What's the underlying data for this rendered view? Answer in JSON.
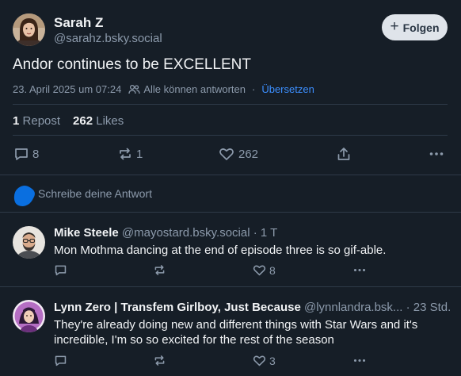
{
  "main_post": {
    "author_name": "Sarah Z",
    "author_handle": "@sarahz.bsky.social",
    "follow_label": "Folgen",
    "text": "Andor continues to be EXCELLENT",
    "timestamp": "23. April 2025 um 07:24",
    "reply_setting": "Alle können antworten",
    "translate_label": "Übersetzen",
    "reposts_count": "1",
    "reposts_label": "Repost",
    "likes_count": "262",
    "likes_label": "Likes",
    "actions": {
      "reply_count": "8",
      "repost_count": "1",
      "like_count": "262"
    }
  },
  "composer": {
    "placeholder": "Schreibe deine Antwort"
  },
  "replies": [
    {
      "author_name": "Mike Steele",
      "author_handle": "@mayostard.bsky.social",
      "time": "1 T",
      "text": "Mon Mothma dancing at the end of episode three is so gif-able.",
      "like_count": "8"
    },
    {
      "author_name": "Lynn Zero | Transfem Girlboy, Just Because",
      "author_handle": "@lynnlandra.bsk...",
      "time": "23 Std.",
      "text": "They're already doing new and different things with Star Wars and it's incredible, I'm so so excited for the rest of the season",
      "like_count": "3"
    }
  ],
  "colors": {
    "background": "#161e27",
    "text": "#f1f3f5",
    "muted": "#8c9aab",
    "accent": "#3c8fff",
    "divider": "#2e3a48",
    "follow_button_bg": "#dfe4ea"
  },
  "icons": [
    "plus-icon",
    "people-icon",
    "reply-icon",
    "repost-icon",
    "heart-icon",
    "share-icon",
    "more-icon"
  ]
}
